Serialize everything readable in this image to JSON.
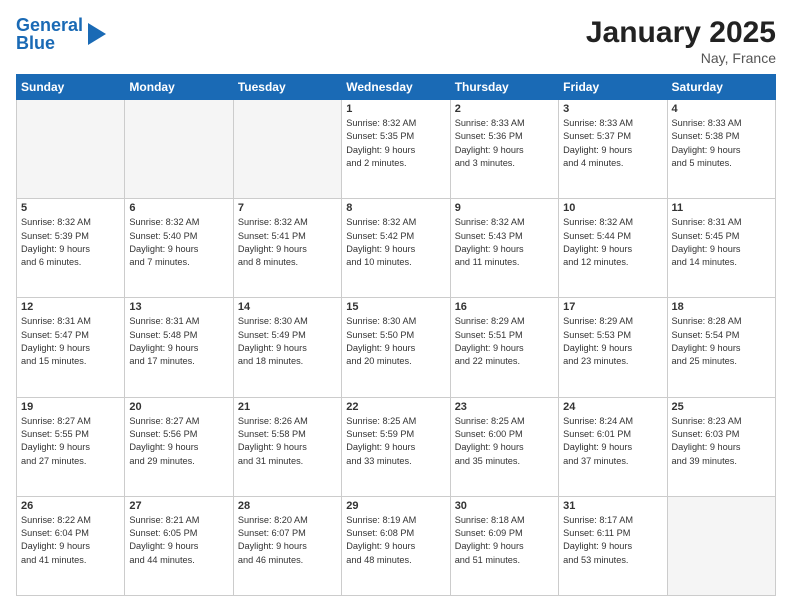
{
  "header": {
    "logo_general": "General",
    "logo_blue": "Blue",
    "month": "January 2025",
    "location": "Nay, France"
  },
  "weekdays": [
    "Sunday",
    "Monday",
    "Tuesday",
    "Wednesday",
    "Thursday",
    "Friday",
    "Saturday"
  ],
  "weeks": [
    [
      {
        "day": "",
        "info": ""
      },
      {
        "day": "",
        "info": ""
      },
      {
        "day": "",
        "info": ""
      },
      {
        "day": "1",
        "info": "Sunrise: 8:32 AM\nSunset: 5:35 PM\nDaylight: 9 hours\nand 2 minutes."
      },
      {
        "day": "2",
        "info": "Sunrise: 8:33 AM\nSunset: 5:36 PM\nDaylight: 9 hours\nand 3 minutes."
      },
      {
        "day": "3",
        "info": "Sunrise: 8:33 AM\nSunset: 5:37 PM\nDaylight: 9 hours\nand 4 minutes."
      },
      {
        "day": "4",
        "info": "Sunrise: 8:33 AM\nSunset: 5:38 PM\nDaylight: 9 hours\nand 5 minutes."
      }
    ],
    [
      {
        "day": "5",
        "info": "Sunrise: 8:32 AM\nSunset: 5:39 PM\nDaylight: 9 hours\nand 6 minutes."
      },
      {
        "day": "6",
        "info": "Sunrise: 8:32 AM\nSunset: 5:40 PM\nDaylight: 9 hours\nand 7 minutes."
      },
      {
        "day": "7",
        "info": "Sunrise: 8:32 AM\nSunset: 5:41 PM\nDaylight: 9 hours\nand 8 minutes."
      },
      {
        "day": "8",
        "info": "Sunrise: 8:32 AM\nSunset: 5:42 PM\nDaylight: 9 hours\nand 10 minutes."
      },
      {
        "day": "9",
        "info": "Sunrise: 8:32 AM\nSunset: 5:43 PM\nDaylight: 9 hours\nand 11 minutes."
      },
      {
        "day": "10",
        "info": "Sunrise: 8:32 AM\nSunset: 5:44 PM\nDaylight: 9 hours\nand 12 minutes."
      },
      {
        "day": "11",
        "info": "Sunrise: 8:31 AM\nSunset: 5:45 PM\nDaylight: 9 hours\nand 14 minutes."
      }
    ],
    [
      {
        "day": "12",
        "info": "Sunrise: 8:31 AM\nSunset: 5:47 PM\nDaylight: 9 hours\nand 15 minutes."
      },
      {
        "day": "13",
        "info": "Sunrise: 8:31 AM\nSunset: 5:48 PM\nDaylight: 9 hours\nand 17 minutes."
      },
      {
        "day": "14",
        "info": "Sunrise: 8:30 AM\nSunset: 5:49 PM\nDaylight: 9 hours\nand 18 minutes."
      },
      {
        "day": "15",
        "info": "Sunrise: 8:30 AM\nSunset: 5:50 PM\nDaylight: 9 hours\nand 20 minutes."
      },
      {
        "day": "16",
        "info": "Sunrise: 8:29 AM\nSunset: 5:51 PM\nDaylight: 9 hours\nand 22 minutes."
      },
      {
        "day": "17",
        "info": "Sunrise: 8:29 AM\nSunset: 5:53 PM\nDaylight: 9 hours\nand 23 minutes."
      },
      {
        "day": "18",
        "info": "Sunrise: 8:28 AM\nSunset: 5:54 PM\nDaylight: 9 hours\nand 25 minutes."
      }
    ],
    [
      {
        "day": "19",
        "info": "Sunrise: 8:27 AM\nSunset: 5:55 PM\nDaylight: 9 hours\nand 27 minutes."
      },
      {
        "day": "20",
        "info": "Sunrise: 8:27 AM\nSunset: 5:56 PM\nDaylight: 9 hours\nand 29 minutes."
      },
      {
        "day": "21",
        "info": "Sunrise: 8:26 AM\nSunset: 5:58 PM\nDaylight: 9 hours\nand 31 minutes."
      },
      {
        "day": "22",
        "info": "Sunrise: 8:25 AM\nSunset: 5:59 PM\nDaylight: 9 hours\nand 33 minutes."
      },
      {
        "day": "23",
        "info": "Sunrise: 8:25 AM\nSunset: 6:00 PM\nDaylight: 9 hours\nand 35 minutes."
      },
      {
        "day": "24",
        "info": "Sunrise: 8:24 AM\nSunset: 6:01 PM\nDaylight: 9 hours\nand 37 minutes."
      },
      {
        "day": "25",
        "info": "Sunrise: 8:23 AM\nSunset: 6:03 PM\nDaylight: 9 hours\nand 39 minutes."
      }
    ],
    [
      {
        "day": "26",
        "info": "Sunrise: 8:22 AM\nSunset: 6:04 PM\nDaylight: 9 hours\nand 41 minutes."
      },
      {
        "day": "27",
        "info": "Sunrise: 8:21 AM\nSunset: 6:05 PM\nDaylight: 9 hours\nand 44 minutes."
      },
      {
        "day": "28",
        "info": "Sunrise: 8:20 AM\nSunset: 6:07 PM\nDaylight: 9 hours\nand 46 minutes."
      },
      {
        "day": "29",
        "info": "Sunrise: 8:19 AM\nSunset: 6:08 PM\nDaylight: 9 hours\nand 48 minutes."
      },
      {
        "day": "30",
        "info": "Sunrise: 8:18 AM\nSunset: 6:09 PM\nDaylight: 9 hours\nand 51 minutes."
      },
      {
        "day": "31",
        "info": "Sunrise: 8:17 AM\nSunset: 6:11 PM\nDaylight: 9 hours\nand 53 minutes."
      },
      {
        "day": "",
        "info": ""
      }
    ]
  ]
}
